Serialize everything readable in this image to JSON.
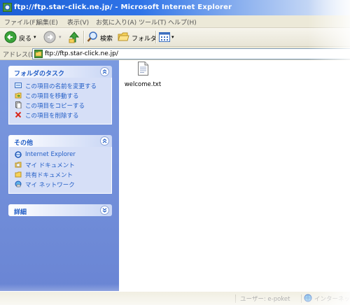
{
  "window": {
    "title": "ftp://ftp.star-click.ne.jp/ - Microsoft Internet Explorer"
  },
  "menu": [
    {
      "label": "ファイル(F)"
    },
    {
      "label": "編集(E)"
    },
    {
      "label": "表示(V)"
    },
    {
      "label": "お気に入り(A)"
    },
    {
      "label": "ツール(T)"
    },
    {
      "label": "ヘルプ(H)"
    }
  ],
  "toolbar": {
    "back_label": "戻る",
    "search_label": "検索",
    "folders_label": "フォルダ"
  },
  "address": {
    "label": "アドレス(D)",
    "value": "ftp://ftp.star-click.ne.jp/"
  },
  "tasks_panel": {
    "title": "フォルダのタスク",
    "items": [
      {
        "label": "この項目の名前を変更する",
        "icon": "rename-icon"
      },
      {
        "label": "この項目を移動する",
        "icon": "move-icon"
      },
      {
        "label": "この項目をコピーする",
        "icon": "copy-icon"
      },
      {
        "label": "この項目を削除する",
        "icon": "delete-icon"
      }
    ]
  },
  "other_panel": {
    "title": "その他",
    "items": [
      {
        "label": "Internet Explorer",
        "icon": "internet-explorer-icon"
      },
      {
        "label": "マイ ドキュメント",
        "icon": "my-documents-icon"
      },
      {
        "label": "共有ドキュメント",
        "icon": "shared-documents-icon"
      },
      {
        "label": "マイ ネットワーク",
        "icon": "my-network-icon"
      }
    ]
  },
  "details_panel": {
    "title": "詳細"
  },
  "files": [
    {
      "name": "welcome.txt",
      "icon": "text-file-icon"
    }
  ],
  "status": {
    "user": "ユーザー: e-poket",
    "zone": "インターネット"
  },
  "colors": {
    "titlebar": "#2f74e8",
    "taskpane": "#7b9ae0",
    "link": "#215dc6"
  }
}
